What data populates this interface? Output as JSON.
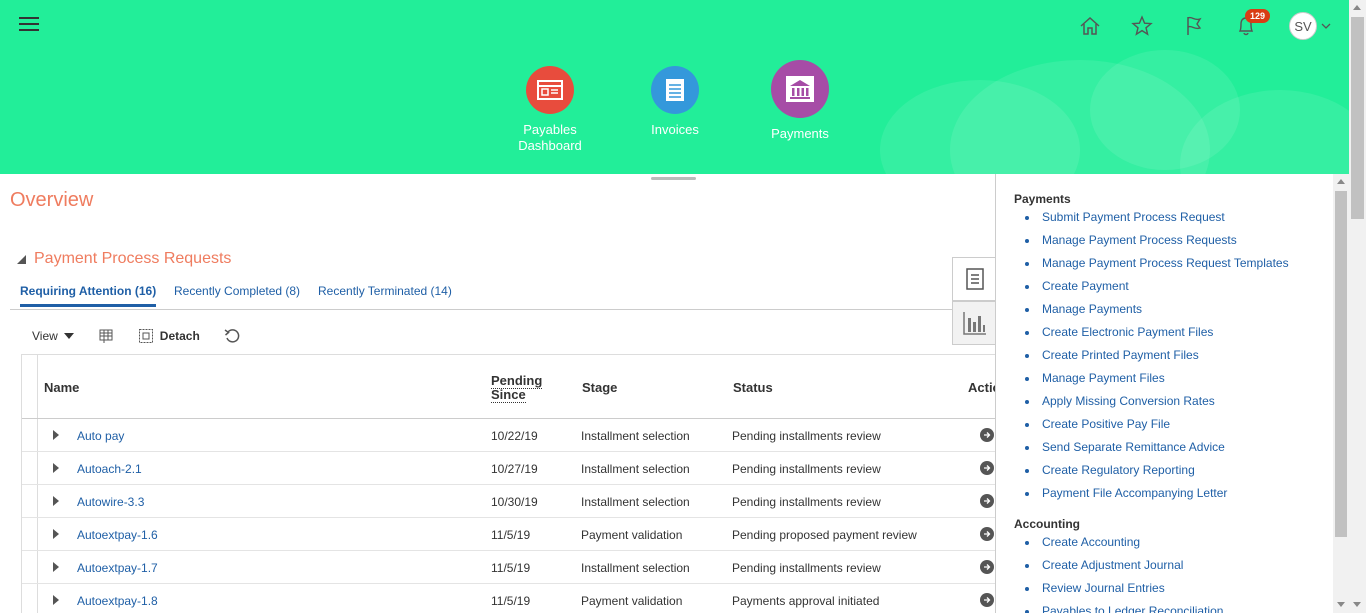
{
  "header": {
    "menu_icon": "hamburger-icon",
    "notifications_count": "129",
    "user_initials": "SV",
    "icons": [
      "home-icon",
      "star-icon",
      "flag-icon",
      "bell-icon"
    ],
    "background_color": "#22ee99"
  },
  "springboard": {
    "items": [
      {
        "label": "Payables Dashboard",
        "icon": "dashboard-icon",
        "color": "#e84c3d"
      },
      {
        "label": "Invoices",
        "icon": "document-icon",
        "color": "#3498db"
      },
      {
        "label": "Payments",
        "icon": "bank-icon",
        "color": "#a64ca6"
      }
    ]
  },
  "main": {
    "page_title": "Overview",
    "section_title": "Payment Process Requests",
    "tabs": [
      {
        "label": "Requiring Attention (16)",
        "active": true
      },
      {
        "label": "Recently Completed (8)",
        "active": false
      },
      {
        "label": "Recently Terminated (14)",
        "active": false
      }
    ],
    "toolbar": {
      "view_label": "View",
      "detach_label": "Detach"
    },
    "table": {
      "columns": [
        "Name",
        "Pending Since",
        "Stage",
        "Status",
        "Actions"
      ],
      "rows": [
        {
          "name": "Auto pay",
          "pending_since": "10/22/19",
          "stage": "Installment selection",
          "status": "Pending installments review"
        },
        {
          "name": "Autoach-2.1",
          "pending_since": "10/27/19",
          "stage": "Installment selection",
          "status": "Pending installments review"
        },
        {
          "name": "Autowire-3.3",
          "pending_since": "10/30/19",
          "stage": "Installment selection",
          "status": "Pending installments review"
        },
        {
          "name": "Autoextpay-1.6",
          "pending_since": "11/5/19",
          "stage": "Payment validation",
          "status": "Pending proposed payment review"
        },
        {
          "name": "Autoextpay-1.7",
          "pending_since": "11/5/19",
          "stage": "Installment selection",
          "status": "Pending installments review"
        },
        {
          "name": "Autoextpay-1.8",
          "pending_since": "11/5/19",
          "stage": "Payment validation",
          "status": "Payments approval initiated"
        }
      ]
    }
  },
  "tasks_panel": {
    "groups": [
      {
        "title": "Payments",
        "links": [
          "Submit Payment Process Request",
          "Manage Payment Process Requests",
          "Manage Payment Process Request Templates",
          "Create Payment",
          "Manage Payments",
          "Create Electronic Payment Files",
          "Create Printed Payment Files",
          "Manage Payment Files",
          "Apply Missing Conversion Rates",
          "Create Positive Pay File",
          "Send Separate Remittance Advice",
          "Create Regulatory Reporting",
          "Payment File Accompanying Letter"
        ]
      },
      {
        "title": "Accounting",
        "links": [
          "Create Accounting",
          "Create Adjustment Journal",
          "Review Journal Entries",
          "Payables to Ledger Reconciliation"
        ]
      }
    ]
  },
  "colors": {
    "accent_title": "#ef7c5f",
    "link": "#1f5fa6"
  }
}
